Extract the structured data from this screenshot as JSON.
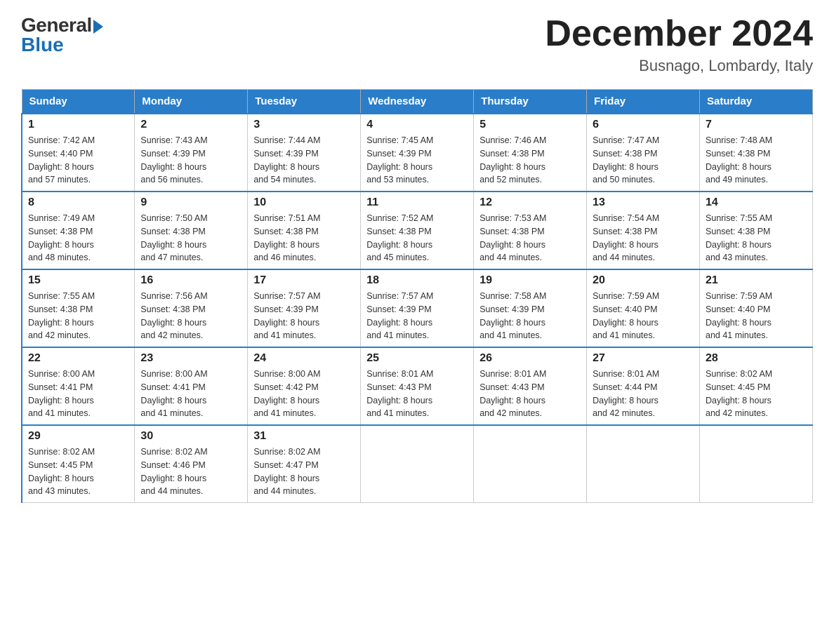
{
  "logo": {
    "general": "General",
    "blue": "Blue"
  },
  "title": {
    "month_year": "December 2024",
    "location": "Busnago, Lombardy, Italy"
  },
  "weekdays": [
    "Sunday",
    "Monday",
    "Tuesday",
    "Wednesday",
    "Thursday",
    "Friday",
    "Saturday"
  ],
  "weeks": [
    [
      {
        "day": "1",
        "sunrise": "7:42 AM",
        "sunset": "4:40 PM",
        "daylight": "8 hours and 57 minutes."
      },
      {
        "day": "2",
        "sunrise": "7:43 AM",
        "sunset": "4:39 PM",
        "daylight": "8 hours and 56 minutes."
      },
      {
        "day": "3",
        "sunrise": "7:44 AM",
        "sunset": "4:39 PM",
        "daylight": "8 hours and 54 minutes."
      },
      {
        "day": "4",
        "sunrise": "7:45 AM",
        "sunset": "4:39 PM",
        "daylight": "8 hours and 53 minutes."
      },
      {
        "day": "5",
        "sunrise": "7:46 AM",
        "sunset": "4:38 PM",
        "daylight": "8 hours and 52 minutes."
      },
      {
        "day": "6",
        "sunrise": "7:47 AM",
        "sunset": "4:38 PM",
        "daylight": "8 hours and 50 minutes."
      },
      {
        "day": "7",
        "sunrise": "7:48 AM",
        "sunset": "4:38 PM",
        "daylight": "8 hours and 49 minutes."
      }
    ],
    [
      {
        "day": "8",
        "sunrise": "7:49 AM",
        "sunset": "4:38 PM",
        "daylight": "8 hours and 48 minutes."
      },
      {
        "day": "9",
        "sunrise": "7:50 AM",
        "sunset": "4:38 PM",
        "daylight": "8 hours and 47 minutes."
      },
      {
        "day": "10",
        "sunrise": "7:51 AM",
        "sunset": "4:38 PM",
        "daylight": "8 hours and 46 minutes."
      },
      {
        "day": "11",
        "sunrise": "7:52 AM",
        "sunset": "4:38 PM",
        "daylight": "8 hours and 45 minutes."
      },
      {
        "day": "12",
        "sunrise": "7:53 AM",
        "sunset": "4:38 PM",
        "daylight": "8 hours and 44 minutes."
      },
      {
        "day": "13",
        "sunrise": "7:54 AM",
        "sunset": "4:38 PM",
        "daylight": "8 hours and 44 minutes."
      },
      {
        "day": "14",
        "sunrise": "7:55 AM",
        "sunset": "4:38 PM",
        "daylight": "8 hours and 43 minutes."
      }
    ],
    [
      {
        "day": "15",
        "sunrise": "7:55 AM",
        "sunset": "4:38 PM",
        "daylight": "8 hours and 42 minutes."
      },
      {
        "day": "16",
        "sunrise": "7:56 AM",
        "sunset": "4:38 PM",
        "daylight": "8 hours and 42 minutes."
      },
      {
        "day": "17",
        "sunrise": "7:57 AM",
        "sunset": "4:39 PM",
        "daylight": "8 hours and 41 minutes."
      },
      {
        "day": "18",
        "sunrise": "7:57 AM",
        "sunset": "4:39 PM",
        "daylight": "8 hours and 41 minutes."
      },
      {
        "day": "19",
        "sunrise": "7:58 AM",
        "sunset": "4:39 PM",
        "daylight": "8 hours and 41 minutes."
      },
      {
        "day": "20",
        "sunrise": "7:59 AM",
        "sunset": "4:40 PM",
        "daylight": "8 hours and 41 minutes."
      },
      {
        "day": "21",
        "sunrise": "7:59 AM",
        "sunset": "4:40 PM",
        "daylight": "8 hours and 41 minutes."
      }
    ],
    [
      {
        "day": "22",
        "sunrise": "8:00 AM",
        "sunset": "4:41 PM",
        "daylight": "8 hours and 41 minutes."
      },
      {
        "day": "23",
        "sunrise": "8:00 AM",
        "sunset": "4:41 PM",
        "daylight": "8 hours and 41 minutes."
      },
      {
        "day": "24",
        "sunrise": "8:00 AM",
        "sunset": "4:42 PM",
        "daylight": "8 hours and 41 minutes."
      },
      {
        "day": "25",
        "sunrise": "8:01 AM",
        "sunset": "4:43 PM",
        "daylight": "8 hours and 41 minutes."
      },
      {
        "day": "26",
        "sunrise": "8:01 AM",
        "sunset": "4:43 PM",
        "daylight": "8 hours and 42 minutes."
      },
      {
        "day": "27",
        "sunrise": "8:01 AM",
        "sunset": "4:44 PM",
        "daylight": "8 hours and 42 minutes."
      },
      {
        "day": "28",
        "sunrise": "8:02 AM",
        "sunset": "4:45 PM",
        "daylight": "8 hours and 42 minutes."
      }
    ],
    [
      {
        "day": "29",
        "sunrise": "8:02 AM",
        "sunset": "4:45 PM",
        "daylight": "8 hours and 43 minutes."
      },
      {
        "day": "30",
        "sunrise": "8:02 AM",
        "sunset": "4:46 PM",
        "daylight": "8 hours and 44 minutes."
      },
      {
        "day": "31",
        "sunrise": "8:02 AM",
        "sunset": "4:47 PM",
        "daylight": "8 hours and 44 minutes."
      },
      null,
      null,
      null,
      null
    ]
  ],
  "labels": {
    "sunrise": "Sunrise:",
    "sunset": "Sunset:",
    "daylight": "Daylight:"
  }
}
